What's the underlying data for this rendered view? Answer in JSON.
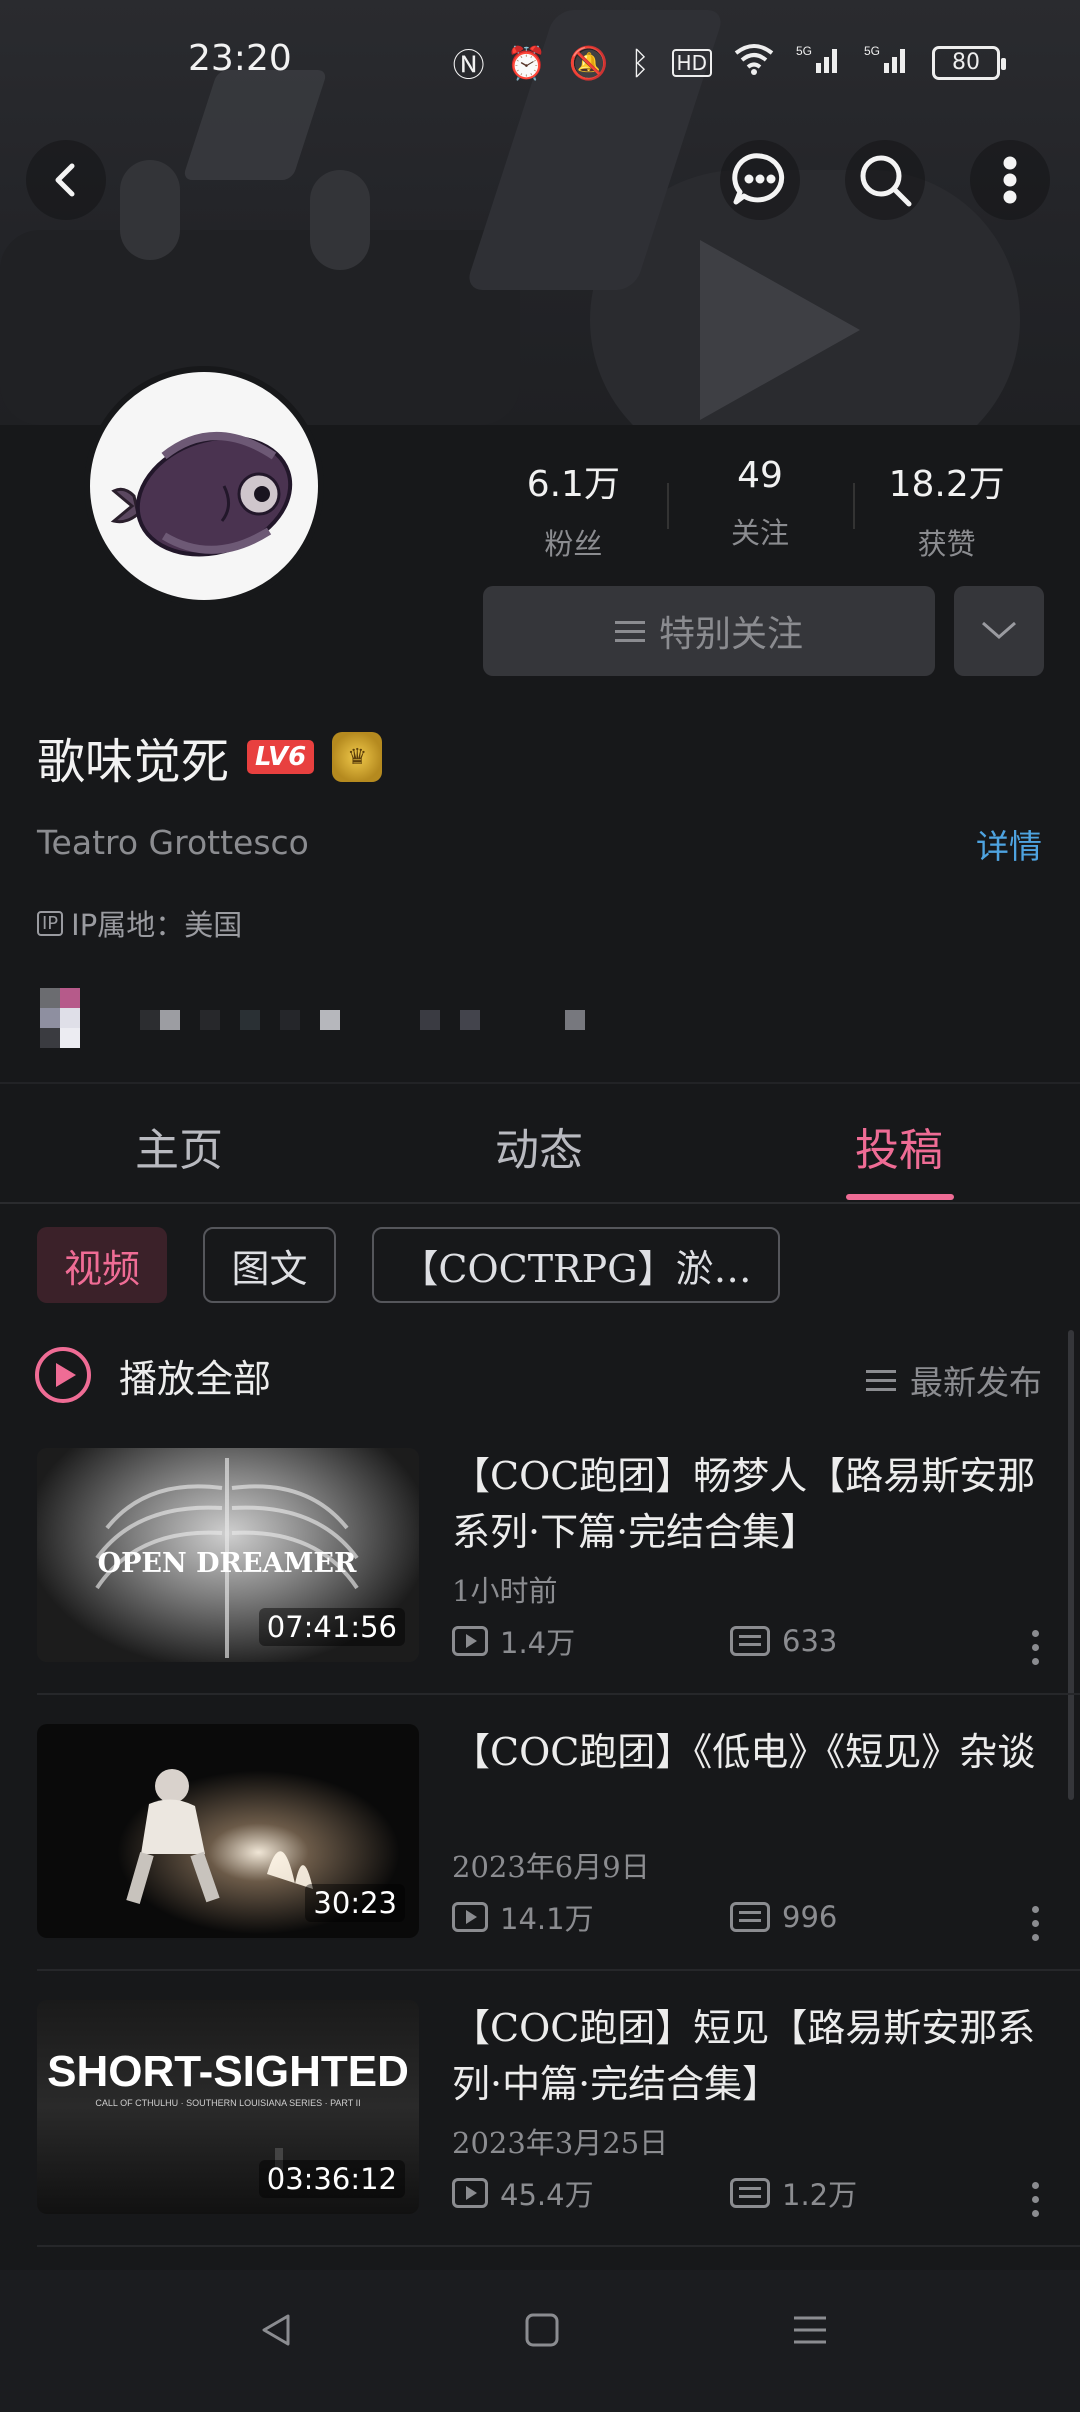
{
  "status_bar": {
    "time": "23:20",
    "battery": "80",
    "icons": [
      "nfc-icon",
      "alarm-icon",
      "mute-icon",
      "bluetooth-icon",
      "hd-icon",
      "wifi-icon",
      "signal-5g-icon",
      "signal-5g-icon"
    ]
  },
  "header": {
    "back_icon": "back-icon",
    "message_icon": "message-icon",
    "search_icon": "search-icon",
    "more_icon": "more-icon"
  },
  "profile": {
    "name": "歌味觉死",
    "level": "LV6",
    "signature": "Teatro Grottesco",
    "detail_link": "详情",
    "ip_label": "IP属地：美国",
    "ip_icon_text": "IP"
  },
  "stats": [
    {
      "value": "6.1万",
      "label": "粉丝"
    },
    {
      "value": "49",
      "label": "关注"
    },
    {
      "value": "18.2万",
      "label": "获赞"
    }
  ],
  "follow_button": {
    "label": "特别关注"
  },
  "tabs": [
    {
      "label": "主页"
    },
    {
      "label": "动态"
    },
    {
      "label": "投稿"
    }
  ],
  "active_tab": "投稿",
  "chips": [
    {
      "label": "视频"
    },
    {
      "label": "图文"
    },
    {
      "label": "【COCTRPG】淤…"
    }
  ],
  "play_all": {
    "label": "播放全部"
  },
  "sort": {
    "label": "最新发布"
  },
  "videos": [
    {
      "title": "【COC跑团】畅梦人【路易斯安那系列·下篇·完结合集】",
      "thumb_text": "OPEN DREAMER",
      "duration": "07:41:56",
      "date": "1小时前",
      "views": "1.4万",
      "danmaku": "633"
    },
    {
      "title": "【COC跑团】《低电》《短见》杂谈",
      "thumb_text": "",
      "duration": "30:23",
      "date": "2023年6月9日",
      "views": "14.1万",
      "danmaku": "996"
    },
    {
      "title": "【COC跑团】短见【路易斯安那系列·中篇·完结合集】",
      "thumb_text": "SHORT-SIGHTED",
      "thumb_subtext": "CALL OF CTHULHU · SOUTHERN LOUISIANA SERIES · PART II",
      "duration": "03:36:12",
      "date": "2023年3月25日",
      "views": "45.4万",
      "danmaku": "1.2万"
    }
  ],
  "colors": {
    "accent": "#ef6c95",
    "link": "#4ea3e0",
    "background": "#17181a"
  }
}
